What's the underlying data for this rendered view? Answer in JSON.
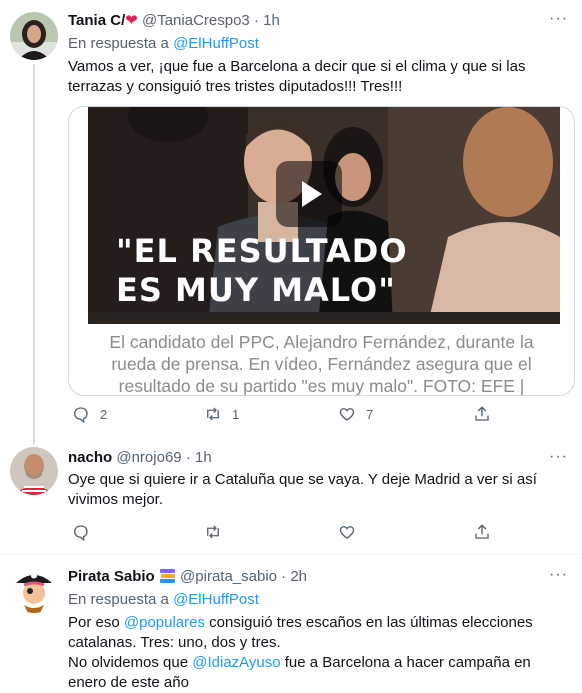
{
  "colors": {
    "link": "#1d9bf0",
    "muted": "#536471",
    "text": "#0f1419",
    "border": "#cfd9de"
  },
  "tweets": [
    {
      "name": "Tania C/",
      "heart": "❤",
      "handle": "@TaniaCrespo3",
      "sep": "·",
      "time": "1h",
      "reply_prefix": "En respuesta a",
      "reply_to": "@ElHuffPost",
      "text": "Vamos a ver, ¡que fue a Barcelona a decir que si el clima y que si las terrazas y consiguió tres tristes diputados!!! Tres!!!",
      "media": {
        "headline_1": "\"EL RESULTADO",
        "headline_2": "ES MUY MALO\"",
        "caption_1": "El candidato del PPC, Alejandro Fernández, durante la",
        "caption_2": "rueda de prensa. En vídeo, Fernández asegura que el",
        "caption_3": "resultado de su partido \"es muy malo\".   FOTO: EFE |"
      },
      "replies": "2",
      "retweets": "1",
      "likes": "7"
    },
    {
      "name": "nacho",
      "handle": "@nrojo69",
      "sep": "·",
      "time": "1h",
      "text": "Oye que si quiere ir a Cataluña que se vaya. Y deje Madrid a ver si así vivimos mejor."
    },
    {
      "name": "Pirata Sabio",
      "badge_icon": "books-icon",
      "handle": "@pirata_sabio",
      "sep": "·",
      "time": "2h",
      "reply_prefix": "En respuesta a",
      "reply_to": "@ElHuffPost",
      "text_1": "Por eso",
      "mention_1": "@populares",
      "text_2": "consiguió tres escaños en las últimas elecciones catalanas. Tres: uno, dos y tres.",
      "text_3": "No olvidemos que",
      "mention_2": "@IdiazAyuso",
      "text_4": "fue a Barcelona a hacer campaña en enero de este año"
    }
  ],
  "more_label": "···"
}
